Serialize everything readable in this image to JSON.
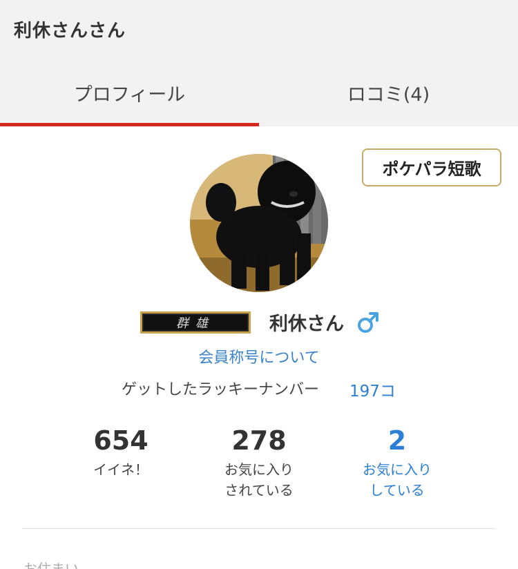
{
  "header": {
    "title": "利休さんさん"
  },
  "tabs": [
    {
      "label": "プロフィール",
      "active": true
    },
    {
      "label": "ロコミ(4)",
      "active": false
    }
  ],
  "tanka_button": {
    "label": "ポケパラ短歌"
  },
  "profile": {
    "title_badge": "群雄",
    "username": "利休さん",
    "gender_icon": "male-icon",
    "member_title_link": "会員称号について",
    "lucky_number_label": "ゲットしたラッキーナンバー",
    "lucky_number_count": "197コ"
  },
  "stats": {
    "likes": {
      "value": "654",
      "label": "イイネ！"
    },
    "favorited": {
      "value": "278",
      "label": "お気に入り\nされている"
    },
    "favoriting": {
      "value": "2",
      "label": "お気に入り\nしている"
    }
  },
  "sections": {
    "residence_label": "お住まい"
  },
  "colors": {
    "tab_indicator": "#d2281e",
    "link_blue": "#2b7fd4",
    "badge_gold": "#c9a96a",
    "male_icon": "#4aa3df"
  }
}
